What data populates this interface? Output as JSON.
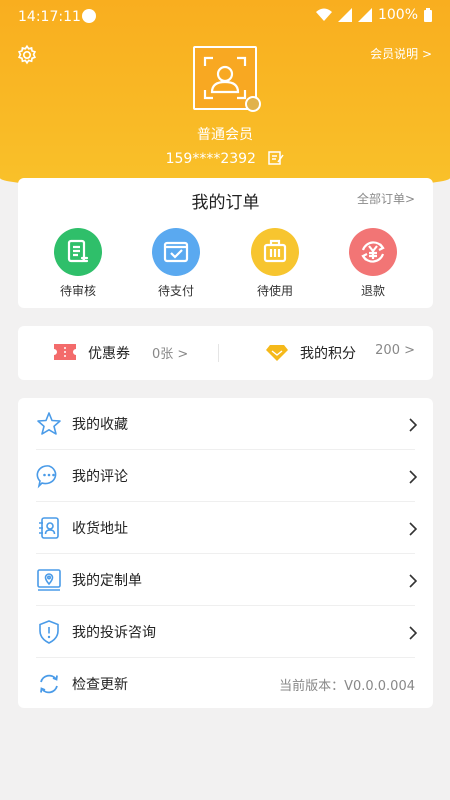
{
  "status_bar": {
    "time": "14:17:11",
    "battery": "100%"
  },
  "header": {
    "member_info_link": "会员说明 >",
    "member_level": "普通会员",
    "phone": "159****2392"
  },
  "orders": {
    "title": "我的订单",
    "all_label": "全部订单>",
    "items": [
      {
        "label": "待审核",
        "color": "#2fbf6a",
        "icon": "review-document-icon"
      },
      {
        "label": "待支付",
        "color": "#5aa9f0",
        "icon": "wallet-check-icon"
      },
      {
        "label": "待使用",
        "color": "#f7c52f",
        "icon": "luggage-icon"
      },
      {
        "label": "退款",
        "color": "#f27575",
        "icon": "refund-yen-icon"
      }
    ]
  },
  "points": {
    "coupon_label": "优惠券",
    "coupon_value": "0张 >",
    "points_label": "我的积分",
    "points_value": "200 >"
  },
  "menu": {
    "items": [
      {
        "label": "我的收藏",
        "icon": "star-icon"
      },
      {
        "label": "我的评论",
        "icon": "comment-bubble-icon"
      },
      {
        "label": "收货地址",
        "icon": "address-book-icon"
      },
      {
        "label": "我的定制单",
        "icon": "map-location-icon"
      },
      {
        "label": "我的投诉咨询",
        "icon": "shield-alert-icon"
      },
      {
        "label": "检查更新",
        "icon": "refresh-icon",
        "value": "当前版本：V0.0.0.004"
      }
    ]
  },
  "colors": {
    "header_top": "#f9ae1f",
    "header_bottom": "#f9c12a",
    "menu_icon": "#4a9be8",
    "background": "#f2f1f1"
  }
}
